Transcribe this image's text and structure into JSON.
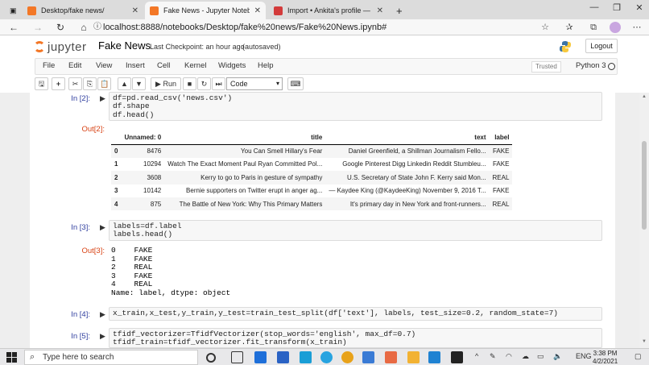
{
  "browser": {
    "tabs": [
      {
        "label": "Desktop/fake news/",
        "favicon_color": "#f37726",
        "active": false
      },
      {
        "label": "Fake News - Jupyter Notebook",
        "favicon_color": "#f37726",
        "active": true
      },
      {
        "label": "Import • Ankita's profile — Word",
        "favicon_color": "#d33b3b",
        "active": false
      }
    ],
    "new_tab": "+",
    "url": "localhost:8888/notebooks/Desktop/fake%20news/Fake%20News.ipynb#"
  },
  "jupyter": {
    "logo_text": "jupyter",
    "notebook_title": "Fake News",
    "checkpoint": "Last Checkpoint: an hour ago",
    "autosave": "(autosaved)",
    "logout": "Logout",
    "menu": [
      "File",
      "Edit",
      "View",
      "Insert",
      "Cell",
      "Kernel",
      "Widgets",
      "Help"
    ],
    "trusted": "Trusted",
    "kernel": "Python 3",
    "toolbar": {
      "run": "Run",
      "cell_type": "Code"
    }
  },
  "cells": {
    "c2": {
      "prompt": "In [2]:",
      "lines": [
        "df=pd.read_csv('news.csv')",
        "df.shape",
        "df.head()"
      ],
      "out_prompt": "Out[2]:"
    },
    "c3": {
      "prompt": "In [3]:",
      "lines": [
        "labels=df.label",
        "labels.head()"
      ],
      "out_prompt": "Out[3]:",
      "output": "0    FAKE\n1    FAKE\n2    REAL\n3    FAKE\n4    REAL\nName: label, dtype: object"
    },
    "c4": {
      "prompt": "In [4]:",
      "line": "x_train,x_test,y_train,y_test=train_test_split(df['text'], labels, test_size=0.2, random_state=7)"
    },
    "c5": {
      "prompt": "In [5]:",
      "lines": [
        "tfidf_vectorizer=TfidfVectorizer(stop_words='english', max_df=0.7)",
        "tfidf_train=tfidf_vectorizer.fit_transform(x_train)"
      ]
    }
  },
  "dataframe": {
    "columns": [
      "",
      "Unnamed: 0",
      "title",
      "text",
      "label"
    ],
    "rows": [
      [
        "0",
        "8476",
        "You Can Smell Hillary's Fear",
        "Daniel Greenfield, a Shillman Journalism Fello...",
        "FAKE"
      ],
      [
        "1",
        "10294",
        "Watch The Exact Moment Paul Ryan Committed Pol...",
        "Google Pinterest Digg Linkedin Reddit Stumbleu...",
        "FAKE"
      ],
      [
        "2",
        "3608",
        "Kerry to go to Paris in gesture of sympathy",
        "U.S. Secretary of State John F. Kerry said Mon...",
        "REAL"
      ],
      [
        "3",
        "10142",
        "Bernie supporters on Twitter erupt in anger ag...",
        "— Kaydee King (@KaydeeKing) November 9, 2016 T...",
        "FAKE"
      ],
      [
        "4",
        "875",
        "The Battle of New York: Why This Primary Matters",
        "It's primary day in New York and front-runners...",
        "REAL"
      ]
    ]
  },
  "taskbar": {
    "search_placeholder": "Type here to search",
    "lang": "ENG",
    "time": "3:38 PM",
    "date": "4/2/2021"
  }
}
